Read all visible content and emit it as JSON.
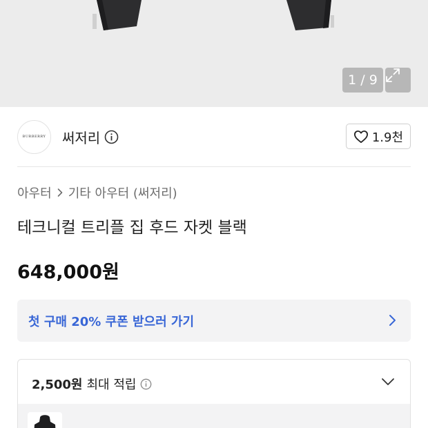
{
  "gallery": {
    "counter": "1 / 9",
    "expand_icon": "expand-icon"
  },
  "brand": {
    "logo_text": "BURBERRY",
    "name": "써저리",
    "info_icon": "info-icon",
    "like_count": "1.9천",
    "like_icon": "heart-icon"
  },
  "breadcrumb": {
    "category": "아우터",
    "separator_icon": "chevron-right-icon",
    "subcategory": "기타 아우터 (써저리)"
  },
  "product": {
    "title": "테크니컬 트리플 집 후드 자켓 블랙",
    "price": "648,000원"
  },
  "coupon": {
    "label": "첫 구매 20% 쿠폰 받으러 가기",
    "accent_color": "#3866d6"
  },
  "points": {
    "amount": "2,500원",
    "label": "최대 적립"
  }
}
